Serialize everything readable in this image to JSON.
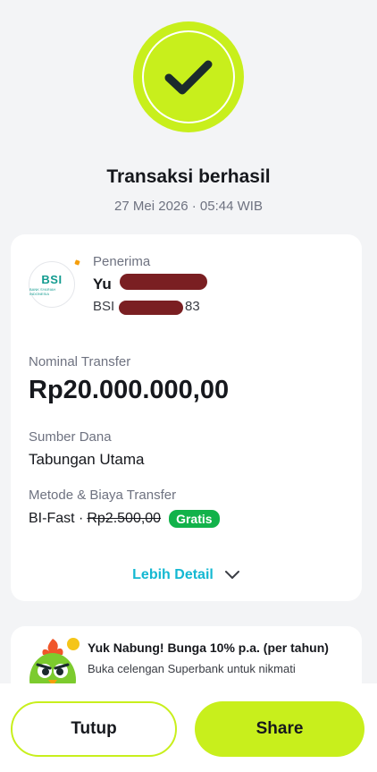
{
  "status": {
    "icon": "checkmark-icon",
    "title": "Transaksi berhasil",
    "datetime": "27 Mei 2026 · 05:44 WIB",
    "accent_color": "#c8ef1c"
  },
  "recipient": {
    "label": "Penerima",
    "bank_logo_text": "BSI",
    "bank_logo_sub": "BANK SYARIAH INDONESIA",
    "name_visible": "Yu",
    "account_prefix": "BSI",
    "account_suffix": "83"
  },
  "transfer": {
    "amount_label": "Nominal Transfer",
    "amount": "Rp20.000.000,00",
    "source_label": "Sumber Dana",
    "source": "Tabungan Utama",
    "method_label": "Metode & Biaya Transfer",
    "method": "BI-Fast ·",
    "original_fee": "Rp2.500,00",
    "fee_badge": "Gratis",
    "badge_color": "#12b24a"
  },
  "detail_link": {
    "label": "Lebih Detail",
    "icon": "chevron-down-icon",
    "color": "#14b8d2"
  },
  "promo": {
    "title": "Yuk Nabung! Bunga 10% p.a. (per tahun)",
    "description": "Buka celengan Superbank untuk nikmati",
    "mascot": "mascot-bird-icon"
  },
  "actions": {
    "close_label": "Tutup",
    "share_label": "Share"
  }
}
